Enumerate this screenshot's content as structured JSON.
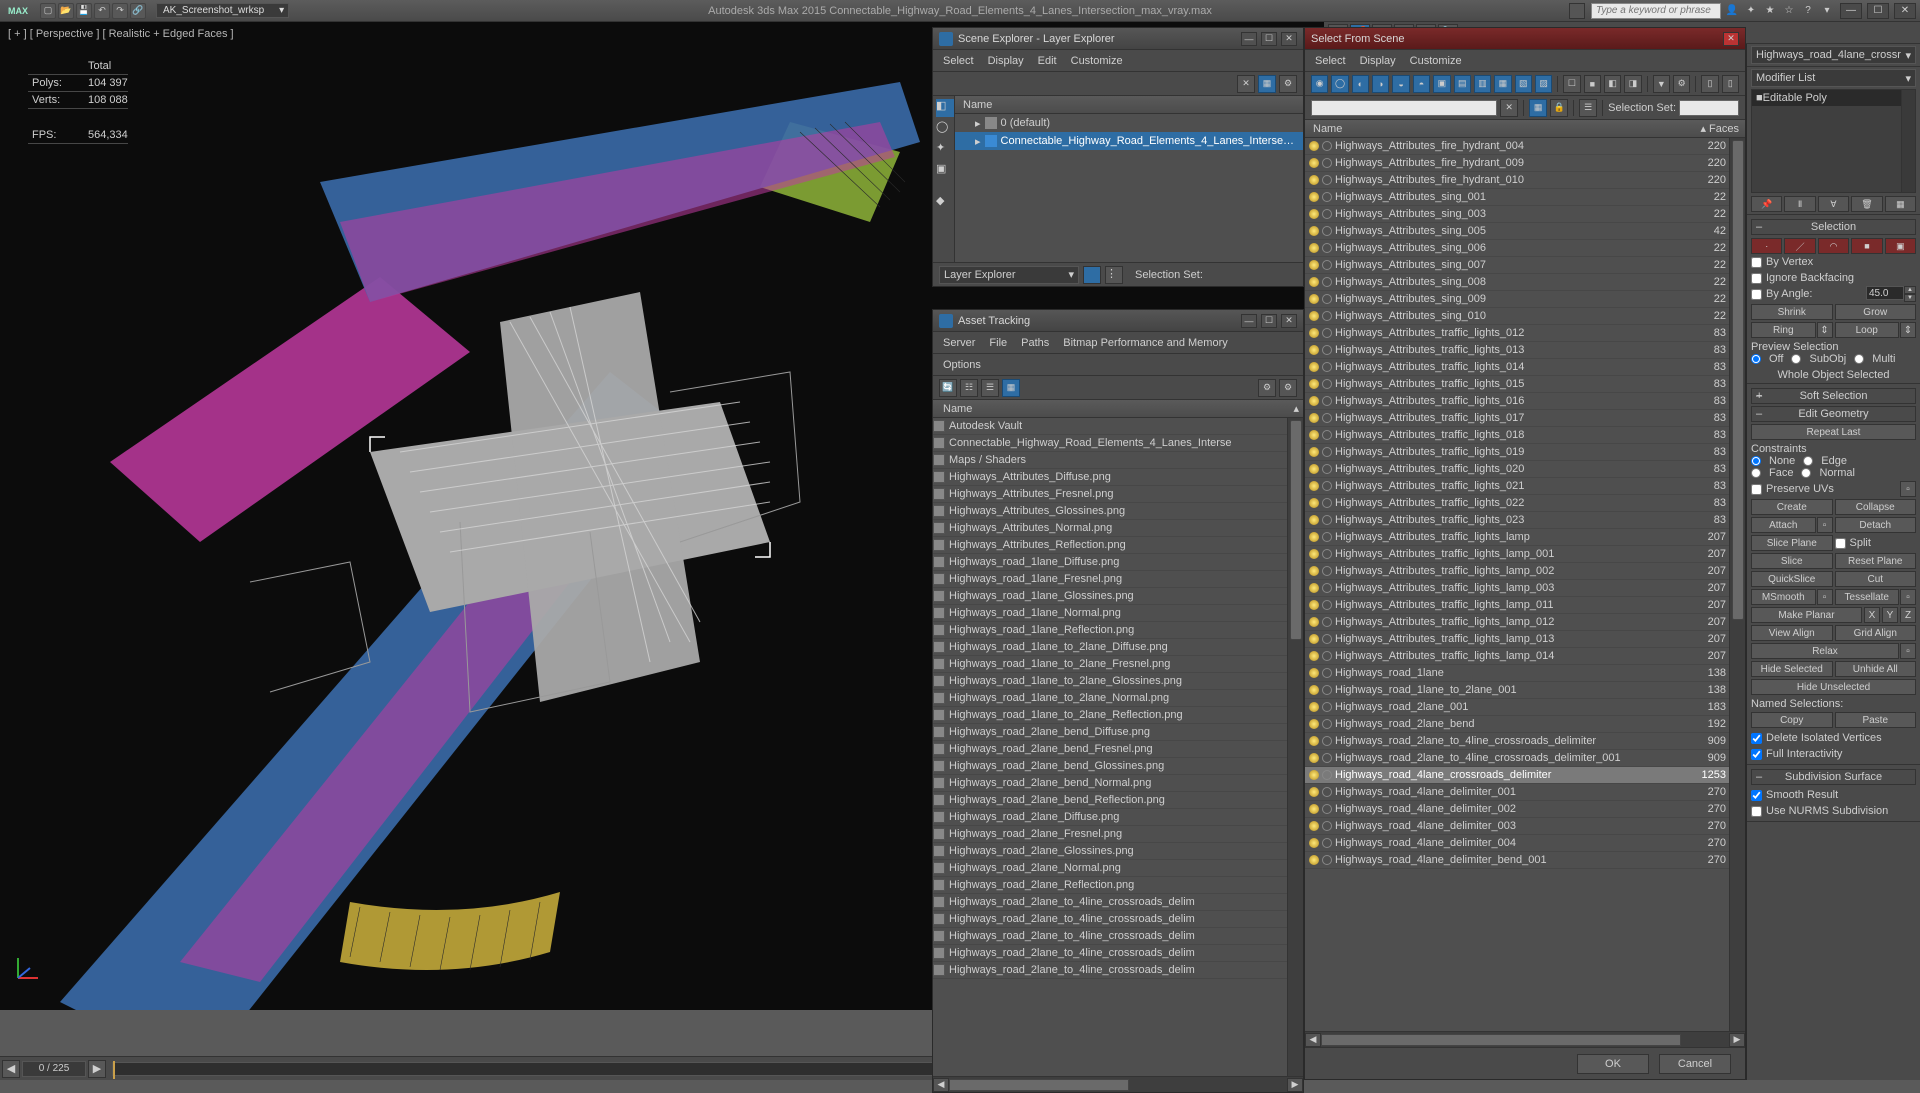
{
  "app": {
    "logo": "MAX",
    "workspace": "AK_Screenshot_wrksp",
    "title": "Autodesk 3ds Max  2015     Connectable_Highway_Road_Elements_4_Lanes_Intersection_max_vray.max",
    "search_placeholder": "Type a keyword or phrase"
  },
  "viewport": {
    "label": "[ + ]  [ Perspective ]  [ Realistic + Edged Faces ]",
    "stats": {
      "total": "Total",
      "polys_label": "Polys:",
      "polys": "104 397",
      "verts_label": "Verts:",
      "verts": "108 088",
      "fps_label": "FPS:",
      "fps": "564,334"
    }
  },
  "timeslider": {
    "frame": "0 / 225"
  },
  "scene_explorer": {
    "title": "Scene Explorer - Layer Explorer",
    "menus": [
      "Select",
      "Display",
      "Edit",
      "Customize"
    ],
    "col_name": "Name",
    "rows": [
      {
        "indent": 1,
        "label": "0 (default)",
        "sel": false
      },
      {
        "indent": 1,
        "label": "Connectable_Highway_Road_Elements_4_Lanes_Interse…",
        "sel": true
      }
    ],
    "footer_label": "Layer Explorer",
    "sel_set_label": "Selection Set:"
  },
  "asset_tracking": {
    "title": "Asset Tracking",
    "menus": [
      "Server",
      "File",
      "Paths",
      "Bitmap Performance and Memory",
      "Options"
    ],
    "col_name": "Name",
    "rows": [
      {
        "i": 0,
        "label": "Autodesk Vault"
      },
      {
        "i": 1,
        "label": "Connectable_Highway_Road_Elements_4_Lanes_Interse"
      },
      {
        "i": 2,
        "label": "Maps / Shaders"
      },
      {
        "i": 3,
        "label": "Highways_Attributes_Diffuse.png"
      },
      {
        "i": 3,
        "label": "Highways_Attributes_Fresnel.png"
      },
      {
        "i": 3,
        "label": "Highways_Attributes_Glossines.png"
      },
      {
        "i": 3,
        "label": "Highways_Attributes_Normal.png"
      },
      {
        "i": 3,
        "label": "Highways_Attributes_Reflection.png"
      },
      {
        "i": 3,
        "label": "Highways_road_1lane_Diffuse.png"
      },
      {
        "i": 3,
        "label": "Highways_road_1lane_Fresnel.png"
      },
      {
        "i": 3,
        "label": "Highways_road_1lane_Glossines.png"
      },
      {
        "i": 3,
        "label": "Highways_road_1lane_Normal.png"
      },
      {
        "i": 3,
        "label": "Highways_road_1lane_Reflection.png"
      },
      {
        "i": 3,
        "label": "Highways_road_1lane_to_2lane_Diffuse.png"
      },
      {
        "i": 3,
        "label": "Highways_road_1lane_to_2lane_Fresnel.png"
      },
      {
        "i": 3,
        "label": "Highways_road_1lane_to_2lane_Glossines.png"
      },
      {
        "i": 3,
        "label": "Highways_road_1lane_to_2lane_Normal.png"
      },
      {
        "i": 3,
        "label": "Highways_road_1lane_to_2lane_Reflection.png"
      },
      {
        "i": 3,
        "label": "Highways_road_2lane_bend_Diffuse.png"
      },
      {
        "i": 3,
        "label": "Highways_road_2lane_bend_Fresnel.png"
      },
      {
        "i": 3,
        "label": "Highways_road_2lane_bend_Glossines.png"
      },
      {
        "i": 3,
        "label": "Highways_road_2lane_bend_Normal.png"
      },
      {
        "i": 3,
        "label": "Highways_road_2lane_bend_Reflection.png"
      },
      {
        "i": 3,
        "label": "Highways_road_2lane_Diffuse.png"
      },
      {
        "i": 3,
        "label": "Highways_road_2lane_Fresnel.png"
      },
      {
        "i": 3,
        "label": "Highways_road_2lane_Glossines.png"
      },
      {
        "i": 3,
        "label": "Highways_road_2lane_Normal.png"
      },
      {
        "i": 3,
        "label": "Highways_road_2lane_Reflection.png"
      },
      {
        "i": 3,
        "label": "Highways_road_2lane_to_4line_crossroads_delim"
      },
      {
        "i": 3,
        "label": "Highways_road_2lane_to_4line_crossroads_delim"
      },
      {
        "i": 3,
        "label": "Highways_road_2lane_to_4line_crossroads_delim"
      },
      {
        "i": 3,
        "label": "Highways_road_2lane_to_4line_crossroads_delim"
      },
      {
        "i": 3,
        "label": "Highways_road_2lane_to_4line_crossroads_delim"
      }
    ]
  },
  "select_scene": {
    "title": "Select From Scene",
    "menus": [
      "Select",
      "Display",
      "Customize"
    ],
    "sel_set_label": "Selection Set:",
    "col_name": "Name",
    "col_faces": "Faces",
    "ok": "OK",
    "cancel": "Cancel",
    "rows": [
      {
        "n": "Highways_Attributes_fire_hydrant_004",
        "f": "220"
      },
      {
        "n": "Highways_Attributes_fire_hydrant_009",
        "f": "220"
      },
      {
        "n": "Highways_Attributes_fire_hydrant_010",
        "f": "220"
      },
      {
        "n": "Highways_Attributes_sing_001",
        "f": "22"
      },
      {
        "n": "Highways_Attributes_sing_003",
        "f": "22"
      },
      {
        "n": "Highways_Attributes_sing_005",
        "f": "42"
      },
      {
        "n": "Highways_Attributes_sing_006",
        "f": "22"
      },
      {
        "n": "Highways_Attributes_sing_007",
        "f": "22"
      },
      {
        "n": "Highways_Attributes_sing_008",
        "f": "22"
      },
      {
        "n": "Highways_Attributes_sing_009",
        "f": "22"
      },
      {
        "n": "Highways_Attributes_sing_010",
        "f": "22"
      },
      {
        "n": "Highways_Attributes_traffic_lights_012",
        "f": "83"
      },
      {
        "n": "Highways_Attributes_traffic_lights_013",
        "f": "83"
      },
      {
        "n": "Highways_Attributes_traffic_lights_014",
        "f": "83"
      },
      {
        "n": "Highways_Attributes_traffic_lights_015",
        "f": "83"
      },
      {
        "n": "Highways_Attributes_traffic_lights_016",
        "f": "83"
      },
      {
        "n": "Highways_Attributes_traffic_lights_017",
        "f": "83"
      },
      {
        "n": "Highways_Attributes_traffic_lights_018",
        "f": "83"
      },
      {
        "n": "Highways_Attributes_traffic_lights_019",
        "f": "83"
      },
      {
        "n": "Highways_Attributes_traffic_lights_020",
        "f": "83"
      },
      {
        "n": "Highways_Attributes_traffic_lights_021",
        "f": "83"
      },
      {
        "n": "Highways_Attributes_traffic_lights_022",
        "f": "83"
      },
      {
        "n": "Highways_Attributes_traffic_lights_023",
        "f": "83"
      },
      {
        "n": "Highways_Attributes_traffic_lights_lamp",
        "f": "207"
      },
      {
        "n": "Highways_Attributes_traffic_lights_lamp_001",
        "f": "207"
      },
      {
        "n": "Highways_Attributes_traffic_lights_lamp_002",
        "f": "207"
      },
      {
        "n": "Highways_Attributes_traffic_lights_lamp_003",
        "f": "207"
      },
      {
        "n": "Highways_Attributes_traffic_lights_lamp_011",
        "f": "207"
      },
      {
        "n": "Highways_Attributes_traffic_lights_lamp_012",
        "f": "207"
      },
      {
        "n": "Highways_Attributes_traffic_lights_lamp_013",
        "f": "207"
      },
      {
        "n": "Highways_Attributes_traffic_lights_lamp_014",
        "f": "207"
      },
      {
        "n": "Highways_road_1lane",
        "f": "138"
      },
      {
        "n": "Highways_road_1lane_to_2lane_001",
        "f": "138"
      },
      {
        "n": "Highways_road_2lane_001",
        "f": "183"
      },
      {
        "n": "Highways_road_2lane_bend",
        "f": "192"
      },
      {
        "n": "Highways_road_2lane_to_4line_crossroads_delimiter",
        "f": "909"
      },
      {
        "n": "Highways_road_2lane_to_4line_crossroads_delimiter_001",
        "f": "909"
      },
      {
        "n": "Highways_road_4lane_crossroads_delimiter",
        "f": "1253",
        "sel": true
      },
      {
        "n": "Highways_road_4lane_delimiter_001",
        "f": "270"
      },
      {
        "n": "Highways_road_4lane_delimiter_002",
        "f": "270"
      },
      {
        "n": "Highways_road_4lane_delimiter_003",
        "f": "270"
      },
      {
        "n": "Highways_road_4lane_delimiter_004",
        "f": "270"
      },
      {
        "n": "Highways_road_4lane_delimiter_bend_001",
        "f": "270"
      }
    ]
  },
  "cmd": {
    "objname": "Highways_road_4lane_crossr",
    "modlist": "Modifier List",
    "stack": [
      "Editable Poly"
    ],
    "rollups": {
      "selection": "Selection",
      "soft": "Soft Selection",
      "editgeo": "Edit Geometry",
      "subdiv": "Subdivision Surface"
    },
    "by_vertex": "By Vertex",
    "ignore_bf": "Ignore Backfacing",
    "by_angle": "By Angle:",
    "angle_val": "45.0",
    "shrink": "Shrink",
    "grow": "Grow",
    "ring": "Ring",
    "loop": "Loop",
    "prev_sel": "Preview Selection",
    "off": "Off",
    "subobj": "SubObj",
    "multi": "Multi",
    "whole": "Whole Object Selected",
    "repeat": "Repeat Last",
    "constraints": "Constraints",
    "none": "None",
    "edge": "Edge",
    "face": "Face",
    "normal": "Normal",
    "preserve": "Preserve UVs",
    "create": "Create",
    "collapse": "Collapse",
    "attach": "Attach",
    "detach": "Detach",
    "sliceplane": "Slice Plane",
    "split": "Split",
    "slice": "Slice",
    "reset": "Reset Plane",
    "quickslice": "QuickSlice",
    "cut": "Cut",
    "msmooth": "MSmooth",
    "tessellate": "Tessellate",
    "makeplanar": "Make Planar",
    "x": "X",
    "y": "Y",
    "z": "Z",
    "viewalign": "View Align",
    "gridalign": "Grid Align",
    "relax": "Relax",
    "hidesel": "Hide Selected",
    "unhideall": "Unhide All",
    "hideunsel": "Hide Unselected",
    "namedsel": "Named Selections:",
    "copy": "Copy",
    "paste": "Paste",
    "deliso": "Delete Isolated Vertices",
    "fullint": "Full Interactivity",
    "smooth": "Smooth Result",
    "nurms": "Use NURMS Subdivision"
  }
}
